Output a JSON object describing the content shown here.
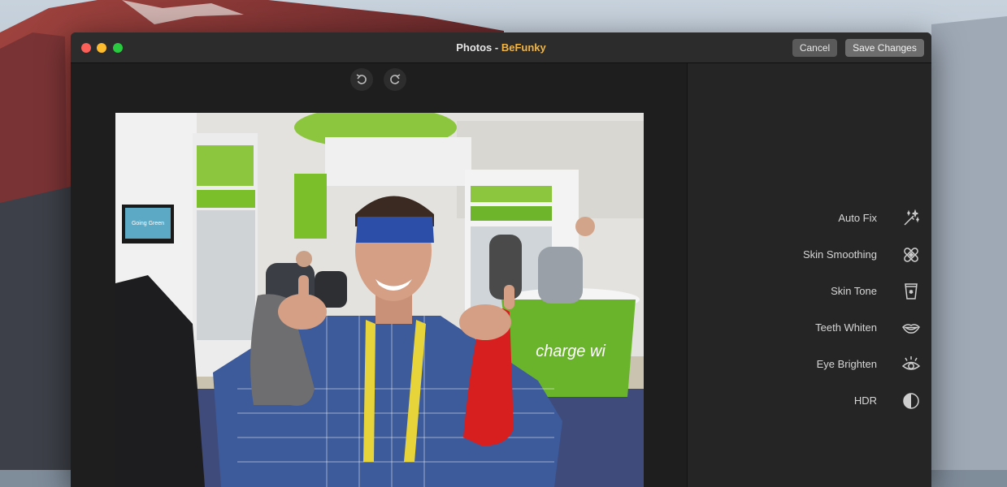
{
  "window": {
    "title_app": "Photos",
    "title_sep": " - ",
    "title_extension": "BeFunky",
    "cancel_label": "Cancel",
    "save_label": "Save Changes"
  },
  "toolbar": {
    "undo_icon": "undo-icon",
    "redo_icon": "redo-icon"
  },
  "photo": {
    "tv_text": "Going Green",
    "banner_text": "charge wi"
  },
  "tools": [
    {
      "label": "Auto Fix",
      "icon": "magic-wand-icon"
    },
    {
      "label": "Skin Smoothing",
      "icon": "bandage-icon"
    },
    {
      "label": "Skin Tone",
      "icon": "lotion-bottle-icon"
    },
    {
      "label": "Teeth Whiten",
      "icon": "lips-icon"
    },
    {
      "label": "Eye Brighten",
      "icon": "eye-icon"
    },
    {
      "label": "HDR",
      "icon": "hdr-icon"
    }
  ],
  "colors": {
    "accent_title": "#f3b542",
    "window_bg": "#1e1e1e",
    "sidebar_bg": "#252525"
  }
}
